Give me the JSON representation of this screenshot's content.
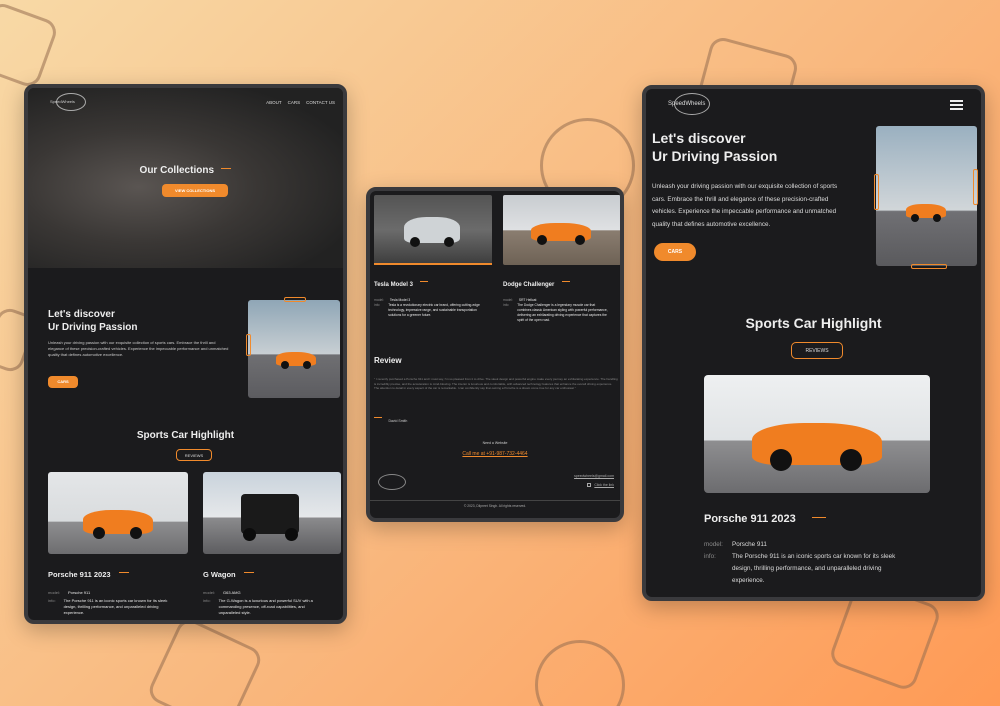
{
  "brand": "SpeedWheels",
  "colors": {
    "accent": "#f08a2c",
    "panel": "#1b1b1d",
    "background": "#f9b77d"
  },
  "left": {
    "nav": [
      "ABOUT",
      "CARS",
      "CONTACT US"
    ],
    "hero_title": "Our Collections",
    "hero_button": "VIEW COLLECTIONS",
    "discover_title_1": "Let's discover",
    "discover_title_2": "Ur Driving Passion",
    "discover_text": "Unleash your driving passion with our exquisite collection of sports cars. Embrace the thrill and elegance of these precision-crafted vehicles. Experience the impeccable performance and unmatched quality that defines automotive excellence.",
    "discover_button": "CARS",
    "highlight_title": "Sports Car Highlight",
    "reviews_button": "REVIEWS",
    "cars": [
      {
        "name": "Porsche 911 2023",
        "model_label": "model:",
        "model": "Porsche 911",
        "info_label": "info:",
        "info": "The Porsche 911 is an iconic sports car known for its sleek design, thrilling performance, and unparalleled driving experience."
      },
      {
        "name": "G Wagon",
        "model_label": "model:",
        "model": "G63 AMG",
        "info_label": "info:",
        "info": "The G-Wagon is a luxurious and powerful SUV with a commanding presence, off-road capabilities, and unparalleled style."
      }
    ]
  },
  "middle": {
    "cars": [
      {
        "name": "Tesla Model 3",
        "model_label": "model:",
        "model": "Tesla Model 3",
        "info_label": "info:",
        "info": "Tesla is a revolutionary electric car brand, offering cutting-edge technology, impressive range, and sustainable transportation solutions for a greener future."
      },
      {
        "name": "Dodge Challenger",
        "model_label": "model:",
        "model": "SRT Hellcat",
        "info_label": "info:",
        "info": "The Dodge Challenger is a legendary muscle car that combines classic American styling with powerful performance, delivering an exhilarating driving experience that captures the spirit of the open road."
      }
    ],
    "review_title": "Review",
    "review_text": "\" I recently purchased a Porsche 911 and I must say, I'm so pleased from it to drive. The sleek design and powerful engine make every journey an exhilarating experience. The handling is incredibly precise, and the acceleration is mind-blowing. The interior is luxurious and comfortable, with advanced technology features that enhance the overall driving experience. The attention to detail in every aspect of the car is remarkable. I can confidently say that owning a Porsche is a dream come true for any car enthusiast \"",
    "reviewer": "David Smith",
    "footer_need": "Need a Website",
    "footer_call": "Call me at +91-987-732-4464",
    "footer_email": "speedwheels@gmail.com",
    "footer_link": "Click the link",
    "copyright": "© 2023, Dilpreet Singh. All rights reserved."
  },
  "right": {
    "discover_title_1": "Let's discover",
    "discover_title_2": "Ur Driving Passion",
    "discover_text": "Unleash your driving passion with our exquisite collection of sports cars. Embrace the thrill and elegance of these precision-crafted vehicles. Experience the impeccable performance and unmatched quality that defines automotive excellence.",
    "discover_button": "CARS",
    "highlight_title": "Sports Car Highlight",
    "reviews_button": "REVIEWS",
    "car": {
      "name": "Porsche 911 2023",
      "model_label": "model:",
      "model": "Porsche 911",
      "info_label": "info:",
      "info": "The Porsche 911 is an iconic sports car known for its sleek design, thrilling performance, and unparalleled driving experience."
    }
  }
}
